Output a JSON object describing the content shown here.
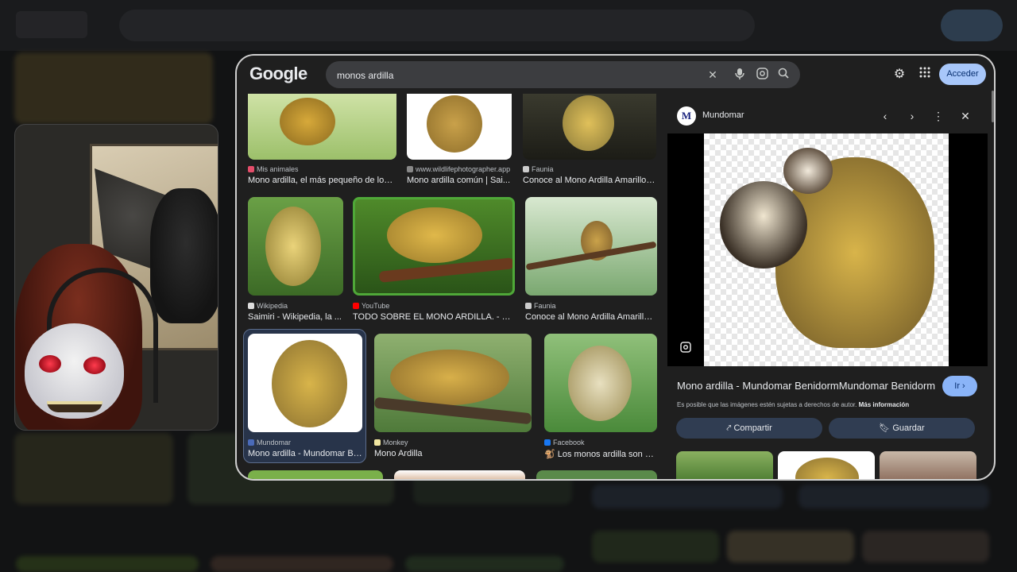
{
  "backdrop": {
    "label": ""
  },
  "header": {
    "logo": "Google",
    "search_value": "monos ardilla",
    "signin_label": "Acceder",
    "icons": [
      "close-icon",
      "mic-icon",
      "lens-icon",
      "search-icon",
      "settings-icon",
      "apps-icon"
    ]
  },
  "grid": {
    "rows": [
      [
        {
          "source": "Mis animales",
          "title": "Mono ardilla, el más pequeño de los p..."
        },
        {
          "source": "www.wildlifephotographer.app",
          "title": "Mono ardilla común | Sai..."
        },
        {
          "source": "Faunia",
          "title": "Conoce al Mono Ardilla Amarillo o..."
        }
      ],
      [
        {
          "source": "Wikipedia",
          "title": "Saimiri - Wikipedia, la ..."
        },
        {
          "source": "YouTube",
          "title": "TODO SOBRE EL MONO ARDILLA. - Yo..."
        },
        {
          "source": "Faunia",
          "title": "Conoce al Mono Ardilla Amarillo ..."
        }
      ],
      [
        {
          "source": "Mundomar",
          "title": "Mono ardilla - Mundomar Be..."
        },
        {
          "source": "Monkey",
          "title": "Mono Ardilla"
        },
        {
          "source": "Facebook",
          "title": "🐒 Los monos ardilla son u..."
        }
      ]
    ]
  },
  "preview": {
    "site_initial": "M",
    "site_name": "Mundomar",
    "title": "Mono ardilla - Mundomar BenidormMundomar Benidorm",
    "go_label": "Ir ›",
    "note_text": "Es posible que las imágenes estén sujetas a derechos de autor.",
    "note_link": "Más información",
    "share_label": "Compartir",
    "save_label": "Guardar"
  },
  "colors": {
    "accent": "#a8c7fa",
    "selected_bg": "#28344a",
    "youtube": "#ff0000",
    "facebook": "#1877f2"
  }
}
